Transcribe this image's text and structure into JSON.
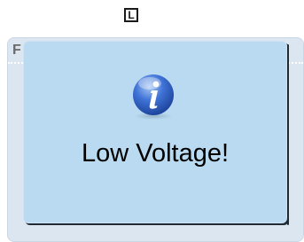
{
  "top_icon": {
    "glyph": "L",
    "icon": "panel-l-icon"
  },
  "group": {
    "label": "F",
    "background": "#dbe6f1"
  },
  "card": {
    "background": "#b9daf0",
    "icon": "info-icon",
    "message": "Low Voltage!"
  }
}
